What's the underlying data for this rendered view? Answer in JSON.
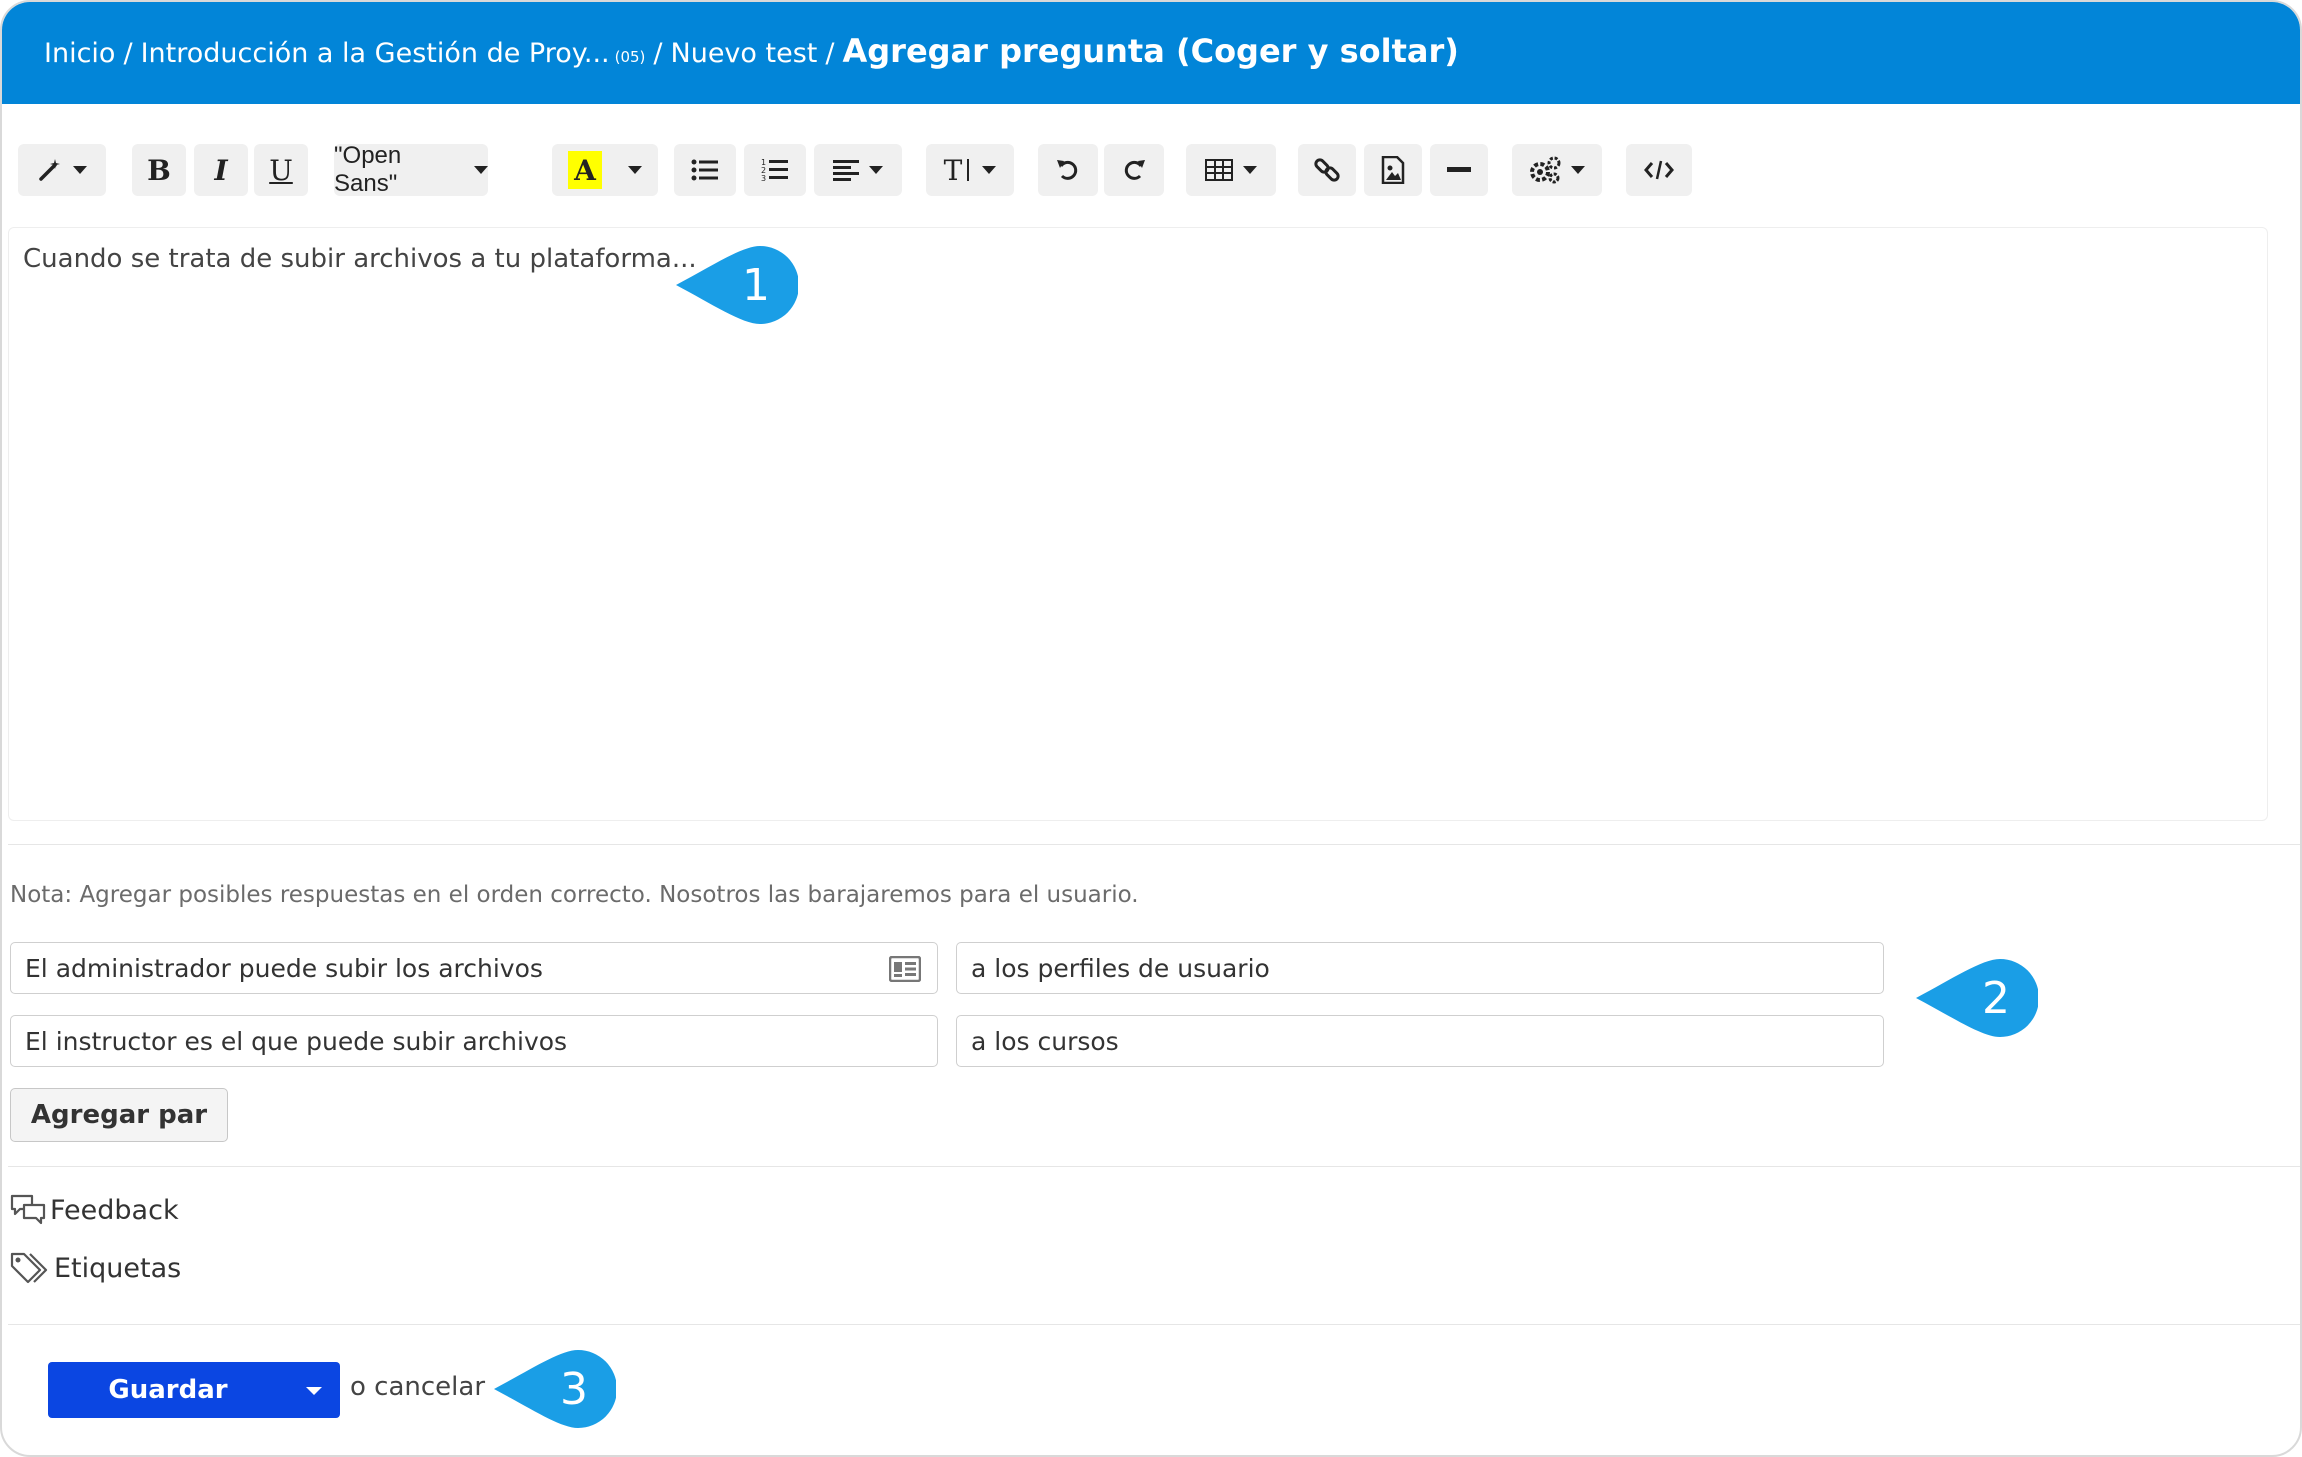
{
  "header": {
    "crumbs": [
      "Inicio",
      "Introducción a la Gestión de Proy...",
      "Nuevo test"
    ],
    "course_code": "(05)",
    "separator": "/",
    "current": "Agregar pregunta (Coger y soltar)"
  },
  "toolbar": {
    "font_family": "\"Open Sans\"",
    "bold": "B",
    "italic": "I",
    "underline": "U",
    "font_color": "A",
    "text_size": "T",
    "highlight_color": "#ffff00"
  },
  "editor": {
    "content": "Cuando se trata de subir archivos a tu plataforma..."
  },
  "note": "Nota: Agregar posibles respuestas en el orden correcto. Nosotros las barajaremos para el usuario.",
  "pairs": [
    {
      "left": "El administrador puede subir los archivos",
      "right": "a los perfiles de usuario"
    },
    {
      "left": "El instructor es el que puede subir archivos",
      "right": "a los cursos"
    }
  ],
  "add_pair_label": "Agregar par",
  "sections": {
    "feedback": "Feedback",
    "tags": "Etiquetas"
  },
  "actions": {
    "save_label": "Guardar",
    "cancel_label": "o cancelar"
  },
  "callouts": [
    "1",
    "2",
    "3"
  ],
  "colors": {
    "header": "#0285d8",
    "save_button": "#0b46e2",
    "callout": "#1a9ee6"
  }
}
